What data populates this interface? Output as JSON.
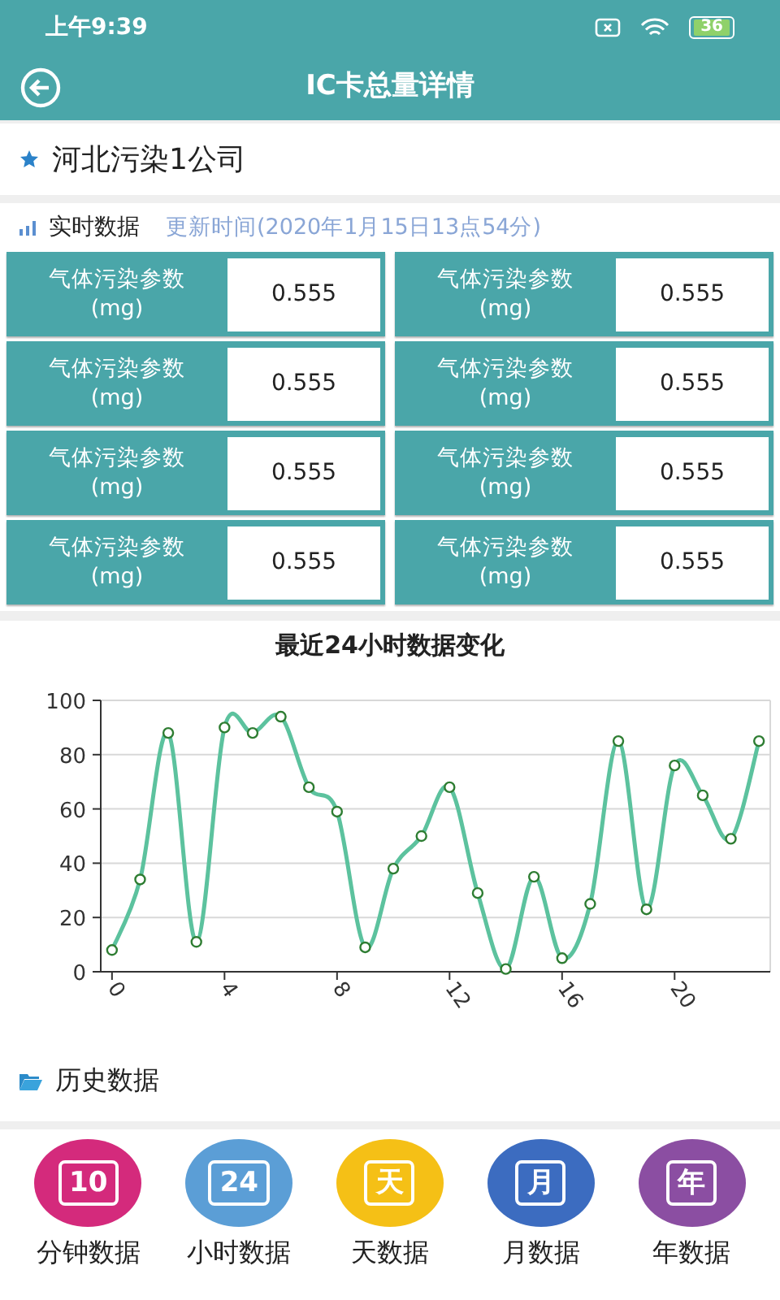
{
  "status_bar": {
    "time": "上午9:39",
    "battery": "36"
  },
  "header": {
    "title": "IC卡总量详情"
  },
  "company": {
    "name": "河北污染1公司"
  },
  "realtime": {
    "label": "实时数据",
    "update_time": "更新时间(2020年1月15日13点54分)"
  },
  "params": [
    {
      "name": "气体污染参数",
      "unit": "(mg)",
      "value": "0.555"
    },
    {
      "name": "气体污染参数",
      "unit": "(mg)",
      "value": "0.555"
    },
    {
      "name": "气体污染参数",
      "unit": "(mg)",
      "value": "0.555"
    },
    {
      "name": "气体污染参数",
      "unit": "(mg)",
      "value": "0.555"
    },
    {
      "name": "气体污染参数",
      "unit": "(mg)",
      "value": "0.555"
    },
    {
      "name": "气体污染参数",
      "unit": "(mg)",
      "value": "0.555"
    },
    {
      "name": "气体污染参数",
      "unit": "(mg)",
      "value": "0.555"
    },
    {
      "name": "气体污染参数",
      "unit": "(mg)",
      "value": "0.555"
    }
  ],
  "chart": {
    "chart_data": {
      "type": "line",
      "title": "最近24小时数据变化",
      "x": [
        0,
        1,
        2,
        3,
        4,
        5,
        6,
        7,
        8,
        9,
        10,
        11,
        12,
        13,
        14,
        15,
        16,
        17,
        18,
        19,
        20,
        21,
        22,
        23
      ],
      "series": [
        {
          "color": "#5cc29e",
          "marker": "circle",
          "values": [
            8,
            34,
            88,
            11,
            90,
            88,
            94,
            68,
            59,
            9,
            38,
            50,
            68,
            29,
            1,
            35,
            5,
            25,
            85,
            23,
            76,
            65,
            49,
            85
          ]
        }
      ],
      "xlim": [
        -0.4,
        23.4
      ],
      "ylim": [
        0,
        100
      ],
      "grid": true,
      "yticks": [
        0,
        20,
        40,
        60,
        80,
        100
      ],
      "xticks": [
        0,
        4,
        8,
        12,
        16,
        20
      ]
    }
  },
  "history": {
    "title": "历史数据",
    "items": [
      {
        "label": "分钟数据",
        "icon_text": "10",
        "color": "#d42a7c"
      },
      {
        "label": "小时数据",
        "icon_text": "24",
        "color": "#5b9ed6"
      },
      {
        "label": "天数据",
        "icon_text": "天",
        "color": "#f5c016"
      },
      {
        "label": "月数据",
        "icon_text": "月",
        "color": "#3c6cc0"
      },
      {
        "label": "年数据",
        "icon_text": "年",
        "color": "#8b4ea2"
      }
    ]
  }
}
